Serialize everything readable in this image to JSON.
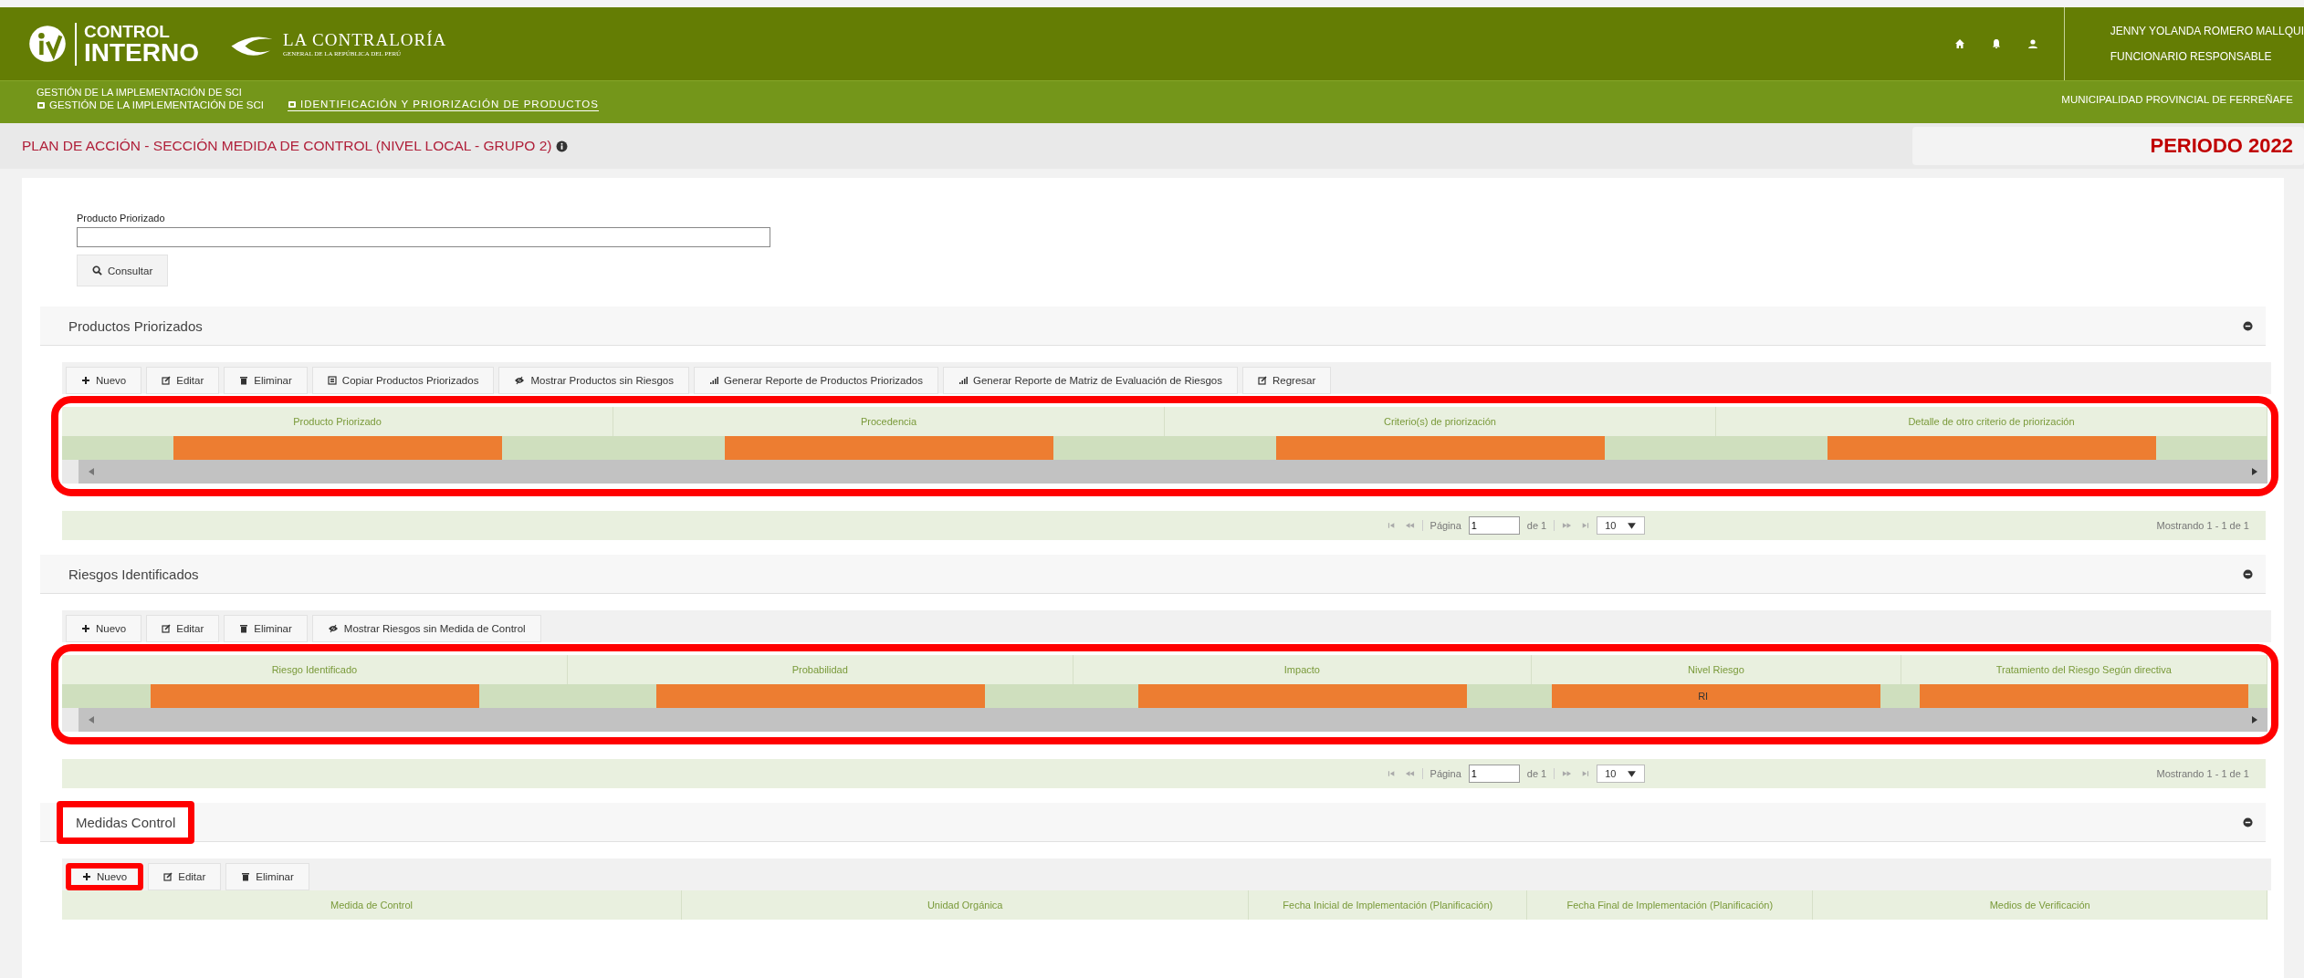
{
  "header": {
    "logo_line_1": "CONTROL",
    "logo_line_2": "INTERNO",
    "org_name": "LA CONTRALORÍA",
    "org_subtitle": "GENERAL DE LA REPÚBLICA DEL PERÚ",
    "user_name": "JENNY YOLANDA ROMERO MALLQUI",
    "user_role": "FUNCIONARIO RESPONSABLE"
  },
  "nav": {
    "top_label": "GESTIÓN DE LA IMPLEMENTACIÓN DE SCI",
    "tabs": [
      {
        "label": "GESTIÓN DE LA IMPLEMENTACIÓN DE SCI",
        "selected": false
      },
      {
        "label": "IDENTIFICACIÓN Y PRIORIZACIÓN DE PRODUCTOS",
        "selected": true
      }
    ],
    "entity": "MUNICIPALIDAD PROVINCIAL DE FERREÑAFE"
  },
  "page": {
    "title": "PLAN DE ACCIÓN - SECCIÓN MEDIDA DE CONTROL (NIVEL LOCAL - GRUPO 2)",
    "period": "PERIODO 2022"
  },
  "search": {
    "label": "Producto Priorizado",
    "button": "Consultar"
  },
  "sections": [
    {
      "title": "Productos Priorizados",
      "highlighted": false,
      "toolbar": [
        {
          "kind": "add",
          "label": "Nuevo",
          "highlighted": false
        },
        {
          "kind": "edit",
          "label": "Editar",
          "highlighted": false
        },
        {
          "kind": "delete",
          "label": "Eliminar",
          "highlighted": false
        },
        {
          "kind": "copy",
          "label": "Copiar Productos Priorizados",
          "highlighted": false
        },
        {
          "kind": "view",
          "label": "Mostrar Productos sin Riesgos",
          "highlighted": false
        },
        {
          "kind": "report",
          "label": "Generar Reporte de Productos Priorizados",
          "highlighted": false
        },
        {
          "kind": "report",
          "label": "Generar Reporte de Matriz de Evaluación de Riesgos",
          "highlighted": false
        },
        {
          "kind": "edit",
          "label": "Regresar",
          "highlighted": false
        }
      ],
      "table": {
        "highlighted": true,
        "h_scrollbar": true,
        "columns": [
          "Producto Priorizado",
          "Procedencia",
          "Criterio(s) de priorización",
          "Detalle de otro criterio de priorización"
        ],
        "rows": [
          [
            {
              "redacted": true
            },
            {
              "redacted": true
            },
            {
              "redacted": true
            },
            {
              "redacted": true
            }
          ]
        ]
      },
      "pager": {
        "page_label": "Página",
        "page": "1",
        "of": "de 1",
        "page_size": "10",
        "summary": "Mostrando 1 - 1 de 1"
      }
    },
    {
      "title": "Riesgos Identificados",
      "highlighted": false,
      "toolbar": [
        {
          "kind": "add",
          "label": "Nuevo",
          "highlighted": false
        },
        {
          "kind": "edit",
          "label": "Editar",
          "highlighted": false
        },
        {
          "kind": "delete",
          "label": "Eliminar",
          "highlighted": false
        },
        {
          "kind": "view",
          "label": "Mostrar Riesgos sin Medida de Control",
          "highlighted": false
        }
      ],
      "table": {
        "highlighted": true,
        "h_scrollbar": true,
        "columns": [
          "Riesgo Identificado",
          "Probabilidad",
          "Impacto",
          "Nivel Riesgo",
          "Tratamiento del Riesgo Según directiva"
        ],
        "rows": [
          [
            {
              "redacted": true
            },
            {
              "redacted": true
            },
            {
              "redacted": true
            },
            {
              "text": "RI",
              "redacted": true
            },
            {
              "redacted": true
            }
          ]
        ]
      },
      "pager": {
        "page_label": "Página",
        "page": "1",
        "of": "de 1",
        "page_size": "10",
        "summary": "Mostrando 1 - 1 de 1"
      }
    },
    {
      "title": "Medidas Control",
      "highlighted": true,
      "toolbar": [
        {
          "kind": "add",
          "label": "Nuevo",
          "highlighted": true
        },
        {
          "kind": "edit",
          "label": "Editar",
          "highlighted": false
        },
        {
          "kind": "delete",
          "label": "Eliminar",
          "highlighted": false
        }
      ],
      "table": {
        "highlighted": false,
        "columns": [
          "Medida de Control",
          "Unidad Orgánica",
          "Fecha Inicial de Implementación (Planificación)",
          "Fecha Final de Implementación (Planificación)",
          "Medios de Verificación"
        ]
      }
    }
  ]
}
